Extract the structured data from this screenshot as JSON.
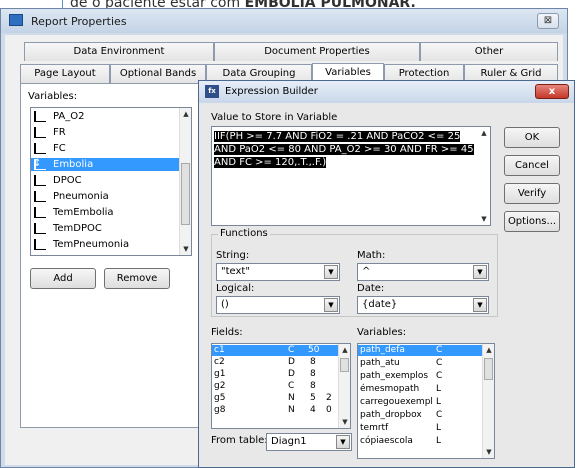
{
  "background_text": {
    "prefix": "de o paciente estar com ",
    "bold": "EMBOLIA PULMONAR."
  },
  "report_properties": {
    "title": "Report Properties",
    "close_label": "⊠",
    "tabs_row1": [
      "Data Environment",
      "Document Properties",
      "Other"
    ],
    "tabs_row2": [
      "Page Layout",
      "Optional Bands",
      "Data Grouping",
      "Variables",
      "Protection",
      "Ruler & Grid"
    ],
    "variables_label": "Variables:",
    "variables": [
      "PA_O2",
      "FR",
      "FC",
      "Embolia",
      "DPOC",
      "Pneumonia",
      "TemEmbolia",
      "TemDPOC",
      "TemPneumonia"
    ],
    "selected_variable": "Embolia",
    "add_label": "Add",
    "remove_label": "Remove"
  },
  "expression_builder": {
    "title": "Expression Builder",
    "close_label": "x",
    "value_label": "Value to Store in Variable",
    "expression": "IIF(PH >= 7.7 AND FiO2 = .21 AND PaCO2 <= 25 AND PaO2 <= 80 AND PA_O2 >= 30 AND FR >= 45 AND FC >= 120,.T.,.F.)",
    "buttons": {
      "ok": "OK",
      "cancel": "Cancel",
      "verify": "Verify",
      "options": "Options..."
    },
    "functions_label": "Functions",
    "string_label": "String:",
    "string_value": "\"text\"",
    "math_label": "Math:",
    "math_value": "^",
    "logical_label": "Logical:",
    "logical_value": "()",
    "date_label": "Date:",
    "date_value": "{date}",
    "fields_label": "Fields:",
    "fields": [
      [
        "c1",
        "C",
        "50"
      ],
      [
        "c2",
        "D",
        "8"
      ],
      [
        "g1",
        "D",
        "8"
      ],
      [
        "g2",
        "C",
        "8"
      ],
      [
        "g5",
        "N",
        "5"
      ],
      [
        "g8",
        "N",
        "4"
      ]
    ],
    "fields_extra": [
      "2",
      "0"
    ],
    "variables_label": "Variables:",
    "variables": [
      [
        "path_defa",
        "C"
      ],
      [
        "path_atu",
        "C"
      ],
      [
        "path_exemplos",
        "C"
      ],
      [
        "émesmopath",
        "L"
      ],
      [
        "carregouexempl",
        "L"
      ],
      [
        "path_dropbox",
        "C"
      ],
      [
        "temrtf",
        "L"
      ],
      [
        "cópiaescola",
        "L"
      ]
    ],
    "from_table_label": "From table:",
    "from_table_value": "Diagn1"
  }
}
